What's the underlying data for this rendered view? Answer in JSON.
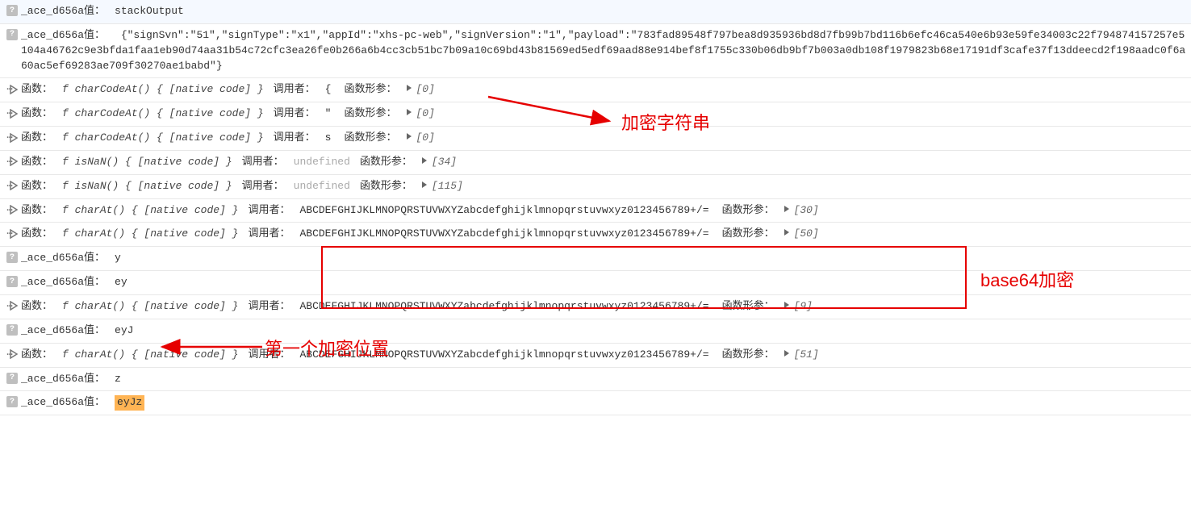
{
  "labels": {
    "var": "_ace_d656a值：",
    "fn": "函数：",
    "caller": "调用者：",
    "args": "函数形参："
  },
  "base64charset": "ABCDEFGHIJKLMNOPQRSTUVWXYZabcdefghijklmnopqrstuvwxyz0123456789+/=",
  "rows": {
    "r0": {
      "value": "stackOutput"
    },
    "r1": {
      "value": "{\"signSvn\":\"51\",\"signType\":\"x1\",\"appId\":\"xhs-pc-web\",\"signVersion\":\"1\",\"payload\":\"783fad89548f797bea8d935936bd8d7fb99b7bd116b6efc46ca540e6b93e59fe34003c22f794874157257e5104a46762c9e3bfda1faa1eb90d74aa31b54c72cfc3ea26fe0b266a6b4cc3cb51bc7b09a10c69bd43b81569ed5edf69aad88e914bef8f1755c330b06db9bf7b003a0db108f1979823b68e17191df3cafe37f13ddeecd2f198aadc0f6a60ac5ef69283ae709f30270ae1babd\"}"
    },
    "r2": {
      "fn": "f charCodeAt() { [native code] }",
      "caller": "{",
      "arg": "[0]"
    },
    "r3": {
      "fn": "f charCodeAt() { [native code] }",
      "caller": "\"",
      "arg": "[0]"
    },
    "r4": {
      "fn": "f charCodeAt() { [native code] }",
      "caller": "s",
      "arg": "[0]"
    },
    "r5": {
      "fn": "f isNaN() { [native code] }",
      "caller": "undefined",
      "arg": "[34]"
    },
    "r6": {
      "fn": "f isNaN() { [native code] }",
      "caller": "undefined",
      "arg": "[115]"
    },
    "r7": {
      "fn": "f charAt() { [native code] }",
      "callerKey": "base64charset",
      "arg": "[30]"
    },
    "r8": {
      "fn": "f charAt() { [native code] }",
      "callerKey": "base64charset",
      "arg": "[50]"
    },
    "r9": {
      "value": "y"
    },
    "r10": {
      "value": "ey"
    },
    "r11": {
      "fn": "f charAt() { [native code] }",
      "callerKey": "base64charset",
      "arg": "[9]"
    },
    "r12": {
      "value": "eyJ"
    },
    "r13": {
      "fn": "f charAt() { [native code] }",
      "callerKey": "base64charset",
      "arg": "[51]"
    },
    "r14": {
      "value": "z"
    },
    "r15": {
      "value": "eyJz"
    }
  },
  "annotations": {
    "a1": "加密字符串",
    "a2": "base64加密",
    "a3": "第一个加密位置"
  }
}
